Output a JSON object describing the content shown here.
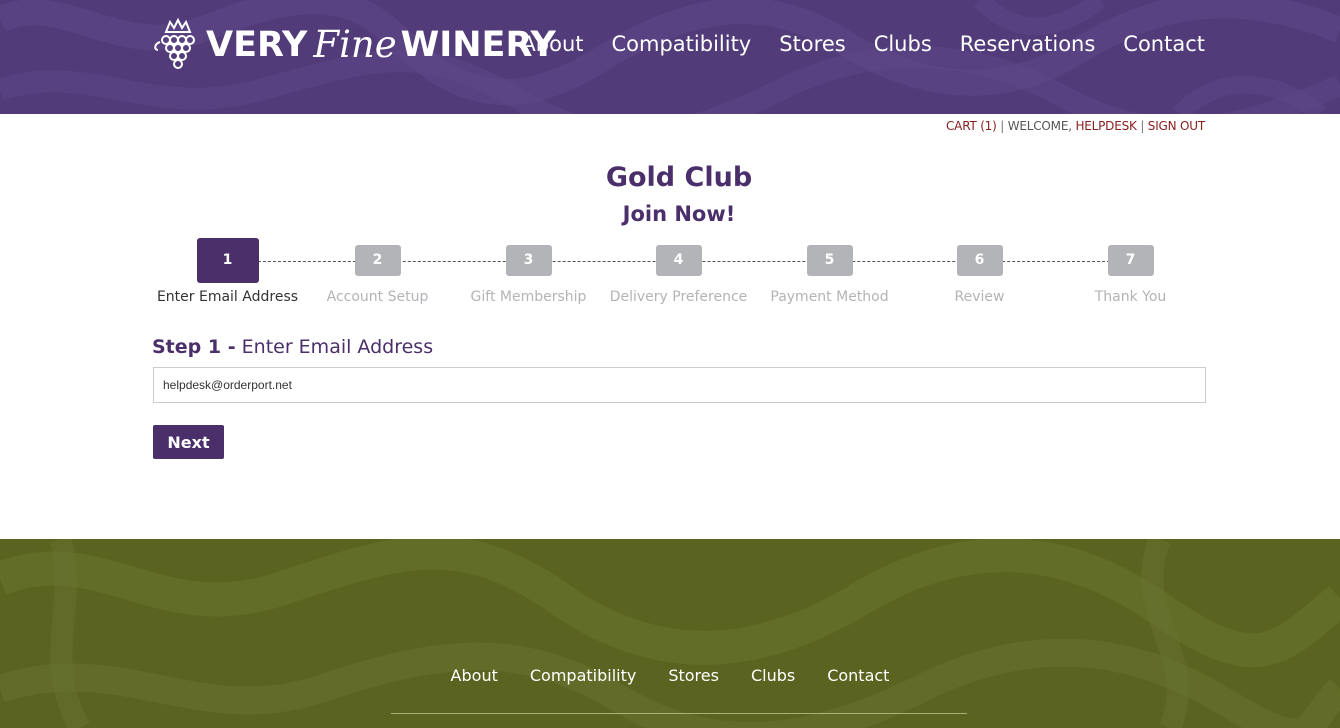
{
  "header": {
    "logo": {
      "very": "VERY",
      "fine": "Fine",
      "winery": "WINERY"
    },
    "nav": [
      "About",
      "Compatibility",
      "Stores",
      "Clubs",
      "Reservations",
      "Contact"
    ]
  },
  "account_bar": {
    "cart": "CART (1)",
    "sep1": "|",
    "welcome": "WELCOME,",
    "user": "HELPDESK",
    "sep2": "|",
    "signout": "SIGN OUT"
  },
  "page": {
    "title": "Gold Club",
    "subtitle": "Join Now!"
  },
  "steps": [
    {
      "number": "1",
      "label": "Enter Email Address",
      "active": true
    },
    {
      "number": "2",
      "label": "Account Setup",
      "active": false
    },
    {
      "number": "3",
      "label": "Gift Membership",
      "active": false
    },
    {
      "number": "4",
      "label": "Delivery Preference",
      "active": false
    },
    {
      "number": "5",
      "label": "Payment Method",
      "active": false
    },
    {
      "number": "6",
      "label": "Review",
      "active": false
    },
    {
      "number": "7",
      "label": "Thank You",
      "active": false
    }
  ],
  "form": {
    "heading_step": "Step 1 -",
    "heading_text": "Enter Email Address",
    "email_value": "helpdesk@orderport.net",
    "next_label": "Next"
  },
  "footer": {
    "nav": [
      "About",
      "Compatibility",
      "Stores",
      "Clubs",
      "Contact"
    ]
  },
  "colors": {
    "header_bg": "#513b78",
    "brand_purple": "#4a2f6a",
    "footer_bg": "#5a6420",
    "inactive_step": "#b3b4b7",
    "link_red": "#8b2020"
  }
}
